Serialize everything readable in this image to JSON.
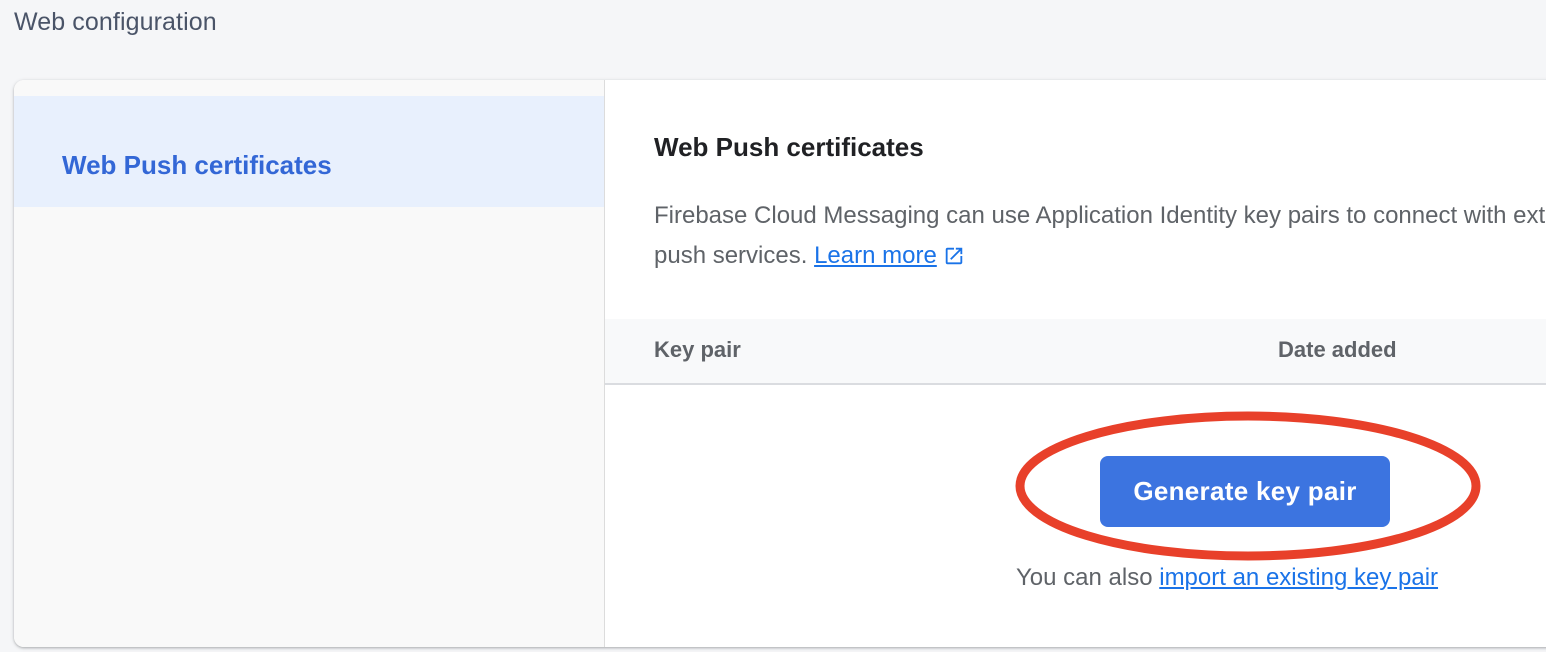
{
  "page": {
    "section_title": "Web configuration"
  },
  "sidebar": {
    "items": [
      {
        "label": "Web Push certificates",
        "selected": true
      }
    ]
  },
  "main": {
    "title": "Web Push certificates",
    "description": "Firebase Cloud Messaging can use Application Identity key pairs to connect with external push services.",
    "learn_more_label": "Learn more",
    "learn_more_icon": "external-link-icon",
    "table": {
      "columns": [
        "Key pair",
        "Date added"
      ],
      "rows": []
    },
    "generate_button_label": "Generate key pair",
    "import_prefix": "You can also ",
    "import_link_label": "import an existing key pair"
  },
  "colors": {
    "accent": "#3c74e0",
    "sidebar_selected_bg": "#e8f0fd",
    "sidebar_selected_text": "#3367d6",
    "link": "#1a73e8",
    "annotation": "#e8402a"
  }
}
